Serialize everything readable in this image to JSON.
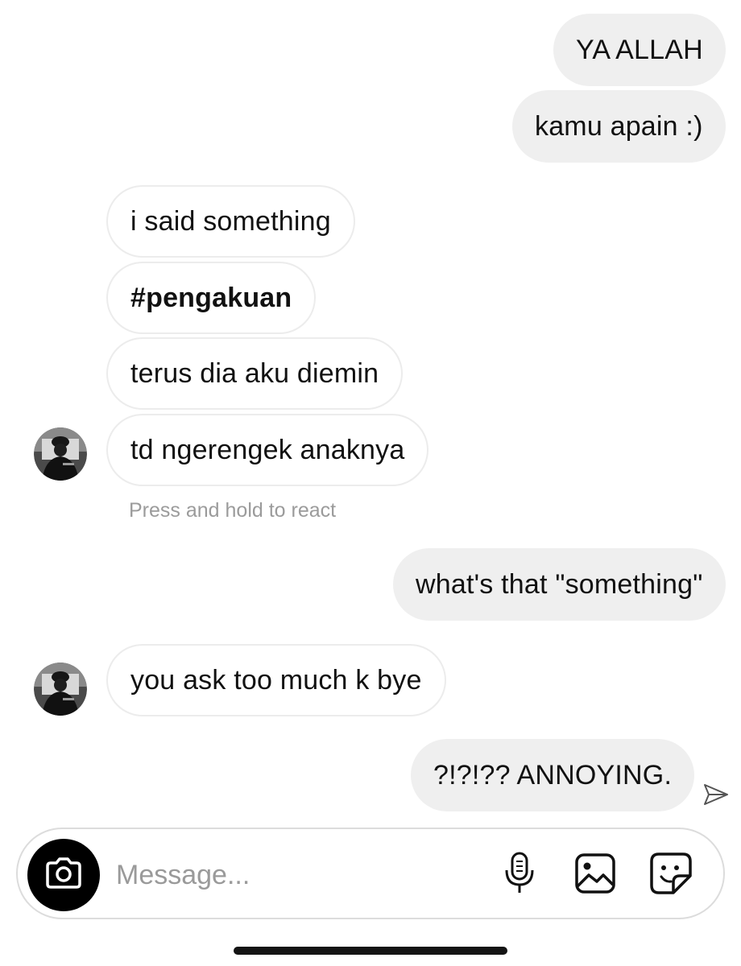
{
  "messages": [
    {
      "text": "YA ALLAH",
      "side": "sent"
    },
    {
      "text": "kamu apain :)",
      "side": "sent"
    },
    {
      "text": "i said something",
      "side": "received"
    },
    {
      "text": "#pengakuan",
      "side": "received"
    },
    {
      "text": "terus dia aku diemin",
      "side": "received"
    },
    {
      "text": "td ngerengek anaknya",
      "side": "received"
    },
    {
      "text": "what's that \"something\"",
      "side": "sent"
    },
    {
      "text": "you ask too much k bye",
      "side": "received"
    },
    {
      "text": "?!?!?? ANNOYING.",
      "side": "sent"
    }
  ],
  "react_hint": "Press and hold to react",
  "composer": {
    "placeholder": "Message..."
  },
  "icons": {
    "camera": "camera-icon",
    "microphone": "microphone-icon",
    "gallery": "gallery-icon",
    "sticker": "sticker-icon",
    "sent_status": "paper-plane-icon"
  },
  "colors": {
    "sent_bubble": "#efefef",
    "received_border": "#ececec",
    "hint_text": "#9b9b9b",
    "camera_button": "#000000"
  }
}
